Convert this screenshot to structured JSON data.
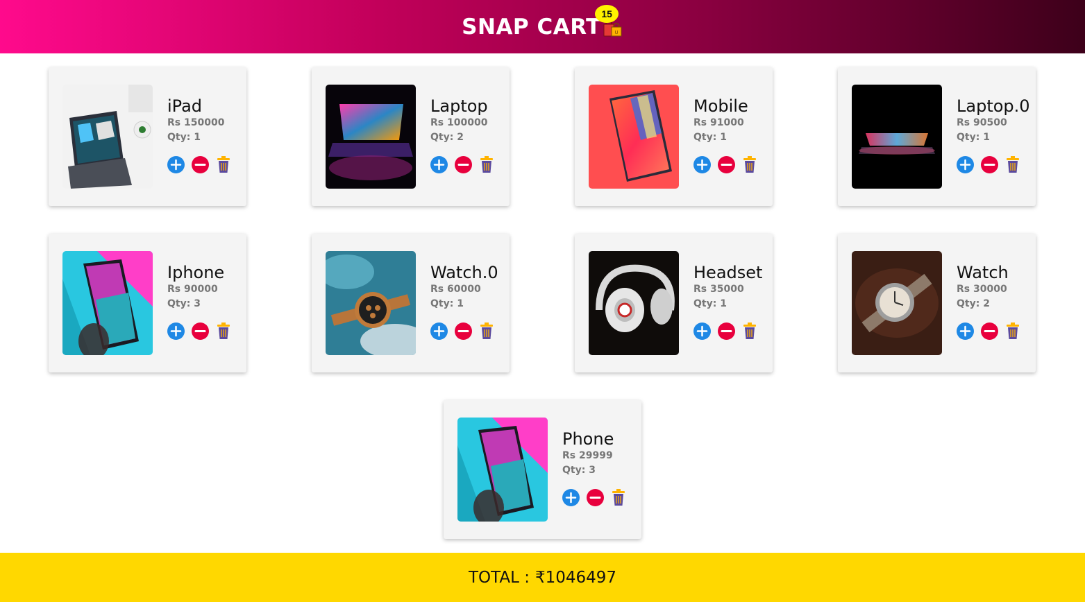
{
  "header": {
    "title": "SNAP CART",
    "badge_count": "15",
    "cart_icon": "shopping-bags-icon"
  },
  "colors": {
    "header_start": "#ff0a8c",
    "header_end": "#3d001a",
    "badge": "#fff200",
    "plus": "#1e88e5",
    "minus": "#e8003d",
    "trash": "#5b4a9e",
    "footer": "#ffd800"
  },
  "items": [
    {
      "name": "iPad",
      "price": "Rs 150000",
      "qty": "Qty: 1"
    },
    {
      "name": "Laptop",
      "price": "Rs 100000",
      "qty": "Qty: 2"
    },
    {
      "name": "Mobile",
      "price": "Rs 91000",
      "qty": "Qty: 1"
    },
    {
      "name": "Laptop.0",
      "price": "Rs 90500",
      "qty": "Qty: 1"
    },
    {
      "name": "Iphone",
      "price": "Rs 90000",
      "qty": "Qty: 3"
    },
    {
      "name": "Watch.0",
      "price": "Rs 60000",
      "qty": "Qty: 1"
    },
    {
      "name": "Headset",
      "price": "Rs 35000",
      "qty": "Qty: 1"
    },
    {
      "name": "Watch",
      "price": "Rs 30000",
      "qty": "Qty: 2"
    },
    {
      "name": "Phone",
      "price": "Rs 29999",
      "qty": "Qty: 3"
    }
  ],
  "footer": {
    "label": "TOTAL :",
    "total": "₹1046497"
  }
}
